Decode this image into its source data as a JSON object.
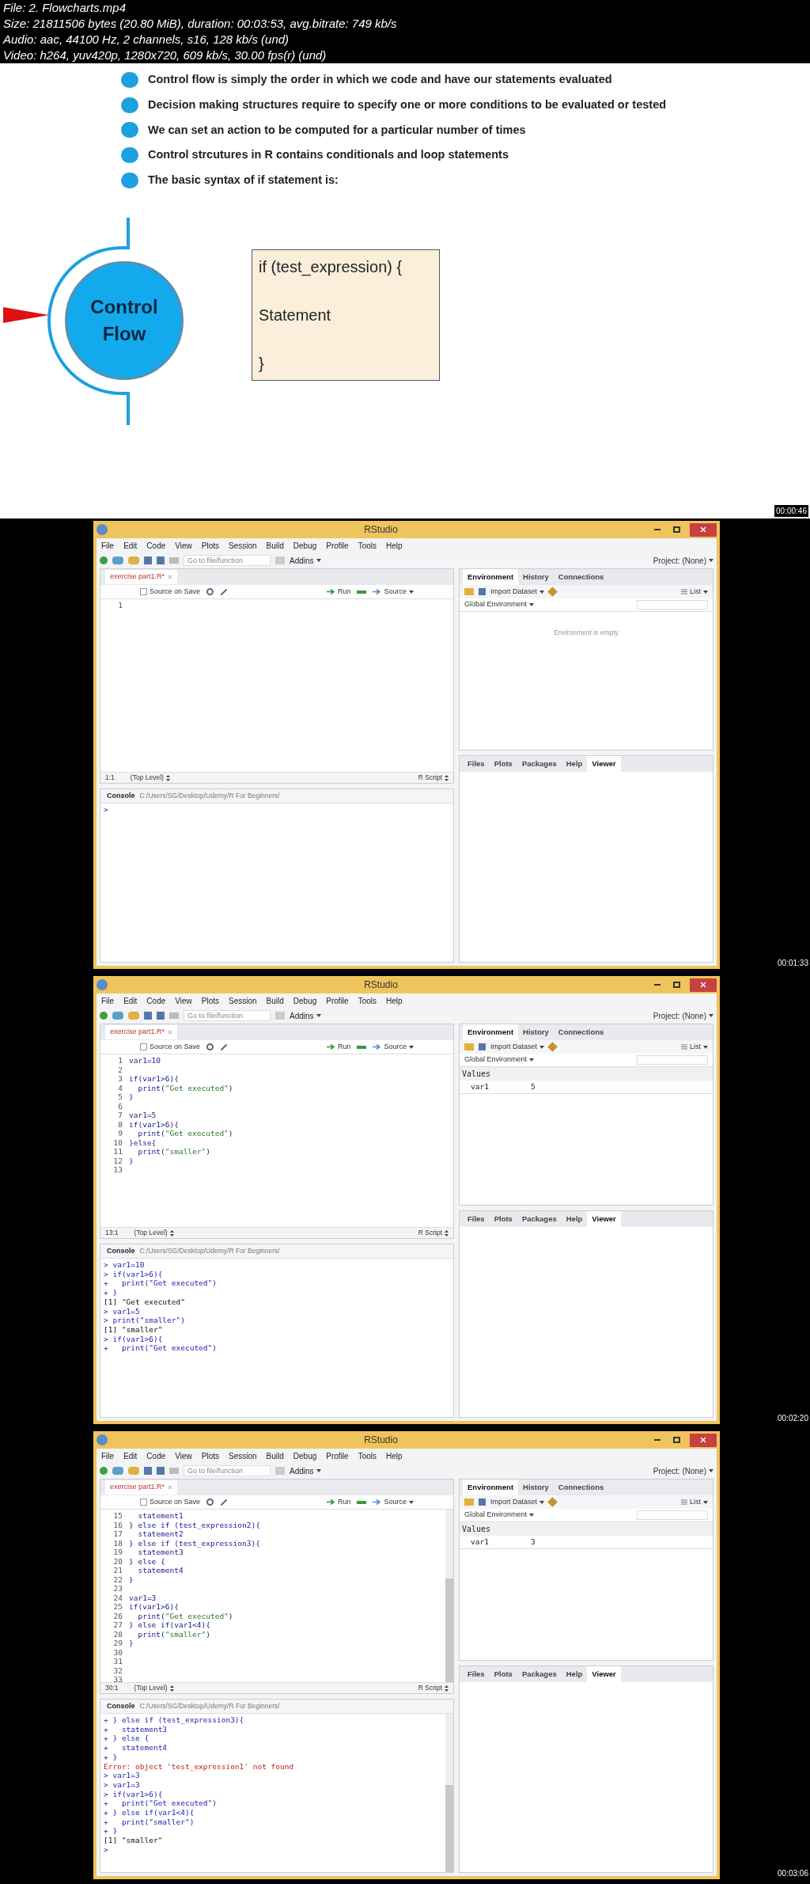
{
  "header": {
    "lines": [
      "File: 2. Flowcharts.mp4",
      "Size: 21811506 bytes (20.80 MiB), duration: 00:03:53, avg.bitrate: 749 kb/s",
      "Audio: aac, 44100 Hz, 2 channels, s16, 128 kb/s (und)",
      "Video: h264, yuv420p, 1280x720, 609 kb/s, 30.00 fps(r) (und)"
    ]
  },
  "frames": [
    {
      "kind": "slide",
      "bullets": [
        "Control flow is simply the order in which we code and have our statements evaluated",
        "Decision making structures require to specify one or more conditions to be evaluated or tested",
        "We can set an action to be computed for a particular number of times",
        "Control strcutures in R contains conditionals and loop statements",
        "The basic syntax of if statement is:"
      ],
      "circle_lines": [
        "Control",
        "Flow"
      ],
      "syntax_box": [
        "if (test_expression) {",
        "Statement",
        "}"
      ],
      "timestamp": "00:00:46"
    },
    {
      "kind": "rstudio",
      "title": "RStudio",
      "menu": [
        "File",
        "Edit",
        "Code",
        "View",
        "Plots",
        "Session",
        "Build",
        "Debug",
        "Profile",
        "Tools",
        "Help"
      ],
      "toolbar": {
        "goto_placeholder": "Go to file/function",
        "addins": "Addins",
        "project": "Project: (None)"
      },
      "editor": {
        "tab": "exercise part1.R*",
        "source_on_save": "Source on Save",
        "source_on_save_checked": false,
        "run": "Run",
        "source": "Source",
        "scrollbar": false,
        "lines": [
          {
            "n": "1"
          }
        ],
        "position": "1:1",
        "scope": "(Top Level)",
        "filetype": "R Script"
      },
      "console": {
        "title": "Console",
        "path": "C:/Users/SG/Desktop/Udemy/R For Beginners/",
        "scrollbar": false,
        "lines": [
          {
            "kind": "input",
            "text": ">"
          }
        ]
      },
      "environment": {
        "tabs": [
          {
            "label": "Environment",
            "selected": true
          },
          {
            "label": "History",
            "selected": false
          },
          {
            "label": "Connections",
            "selected": false
          }
        ],
        "import": "Import Dataset",
        "list": "List",
        "scope": "Global Environment",
        "empty_message": "Environment is empty"
      },
      "files": {
        "tabs": [
          {
            "label": "Files",
            "selected": false
          },
          {
            "label": "Plots",
            "selected": false
          },
          {
            "label": "Packages",
            "selected": false
          },
          {
            "label": "Help",
            "selected": false
          },
          {
            "label": "Viewer",
            "selected": true
          }
        ]
      },
      "timestamp": "00:01:33"
    },
    {
      "kind": "rstudio",
      "title": "RStudio",
      "menu": [
        "File",
        "Edit",
        "Code",
        "View",
        "Plots",
        "Session",
        "Build",
        "Debug",
        "Profile",
        "Tools",
        "Help"
      ],
      "toolbar": {
        "goto_placeholder": "Go to file/function",
        "addins": "Addins",
        "project": "Project: (None)"
      },
      "editor": {
        "tab": "exercise part1.R*",
        "source_on_save": "Source on Save",
        "source_on_save_checked": false,
        "run": "Run",
        "source": "Source",
        "scrollbar": false,
        "lines": [
          {
            "n": "1",
            "code": "var1=10"
          },
          {
            "n": "2"
          },
          {
            "n": "3",
            "code": "if(var1>6){"
          },
          {
            "n": "4",
            "code": "  print(\"Get executed\")"
          },
          {
            "n": "5",
            "code": "}"
          },
          {
            "n": "6"
          },
          {
            "n": "7",
            "code": "var1=5"
          },
          {
            "n": "8",
            "code": "if(var1>6){"
          },
          {
            "n": "9",
            "code": "  print(\"Get executed\")"
          },
          {
            "n": "10",
            "code": "}else{"
          },
          {
            "n": "11",
            "code": "  print(\"smaller\")"
          },
          {
            "n": "12",
            "code": "}"
          },
          {
            "n": "13"
          }
        ],
        "position": "13:1",
        "scope": "(Top Level)",
        "filetype": "R Script"
      },
      "console": {
        "title": "Console",
        "path": "C:/Users/SG/Desktop/Udemy/R For Beginners/",
        "scrollbar": false,
        "lines": [
          {
            "kind": "input",
            "text": "> var1=10"
          },
          {
            "kind": "input",
            "text": "> if(var1>6){"
          },
          {
            "kind": "input",
            "text": "+   print(\"Get executed\")"
          },
          {
            "kind": "input",
            "text": "+ }"
          },
          {
            "kind": "output",
            "text": "[1] \"Get executed\""
          },
          {
            "kind": "input",
            "text": "> var1=5"
          },
          {
            "kind": "input",
            "text": "> print(\"smaller\")"
          },
          {
            "kind": "output",
            "text": "[1] \"smaller\""
          },
          {
            "kind": "input",
            "text": "> if(var1>6){"
          },
          {
            "kind": "input",
            "text": "+   print(\"Get executed\")"
          }
        ]
      },
      "environment": {
        "tabs": [
          {
            "label": "Environment",
            "selected": true
          },
          {
            "label": "History",
            "selected": false
          },
          {
            "label": "Connections",
            "selected": false
          }
        ],
        "import": "Import Dataset",
        "list": "List",
        "scope": "Global Environment",
        "section": "Values",
        "values": [
          {
            "name": "var1",
            "value": "5"
          }
        ]
      },
      "files": {
        "tabs": [
          {
            "label": "Files",
            "selected": false
          },
          {
            "label": "Plots",
            "selected": false
          },
          {
            "label": "Packages",
            "selected": false
          },
          {
            "label": "Help",
            "selected": false
          },
          {
            "label": "Viewer",
            "selected": true
          }
        ]
      },
      "timestamp": "00:02:20"
    },
    {
      "kind": "rstudio",
      "title": "RStudio",
      "menu": [
        "File",
        "Edit",
        "Code",
        "View",
        "Plots",
        "Session",
        "Build",
        "Debug",
        "Profile",
        "Tools",
        "Help"
      ],
      "toolbar": {
        "goto_placeholder": "Go to file/function",
        "addins": "Addins",
        "project": "Project: (None)"
      },
      "editor": {
        "tab": "exercise part1.R*",
        "source_on_save": "Source on Save",
        "source_on_save_checked": false,
        "run": "Run",
        "source": "Source",
        "scrollbar": true,
        "lines": [
          {
            "n": "15",
            "code": "  statement1"
          },
          {
            "n": "16",
            "code": "} else if (test_expression2){"
          },
          {
            "n": "17",
            "code": "  statement2"
          },
          {
            "n": "18",
            "code": "} else if (test_expression3){"
          },
          {
            "n": "19",
            "code": "  statement3"
          },
          {
            "n": "20",
            "code": "} else {"
          },
          {
            "n": "21",
            "code": "  statement4"
          },
          {
            "n": "22",
            "code": "}"
          },
          {
            "n": "23"
          },
          {
            "n": "24",
            "code": "var1=3"
          },
          {
            "n": "25",
            "code": "if(var1>6){"
          },
          {
            "n": "26",
            "code": "  print(\"Get executed\")"
          },
          {
            "n": "27",
            "code": "} else if(var1<4){"
          },
          {
            "n": "28",
            "code": "  print(\"smaller\")"
          },
          {
            "n": "29",
            "code": "}"
          },
          {
            "n": "30"
          },
          {
            "n": "31"
          },
          {
            "n": "32"
          },
          {
            "n": "33"
          }
        ],
        "position": "30:1",
        "scope": "(Top Level)",
        "filetype": "R Script"
      },
      "console": {
        "title": "Console",
        "path": "C:/Users/SG/Desktop/Udemy/R For Beginners/",
        "scrollbar": true,
        "lines": [
          {
            "kind": "input",
            "text": "+ } else if (test_expression3){"
          },
          {
            "kind": "input",
            "text": "+   statement3"
          },
          {
            "kind": "input",
            "text": "+ } else {"
          },
          {
            "kind": "input",
            "text": "+   statement4"
          },
          {
            "kind": "input",
            "text": "+ }"
          },
          {
            "kind": "error",
            "text": "Error: object 'test_expression1' not found"
          },
          {
            "kind": "input",
            "text": "> var1=3"
          },
          {
            "kind": "input",
            "text": "> var1=3"
          },
          {
            "kind": "input",
            "text": "> if(var1>6){"
          },
          {
            "kind": "input",
            "text": "+   print(\"Get executed\")"
          },
          {
            "kind": "input",
            "text": "+ } else if(var1<4){"
          },
          {
            "kind": "input",
            "text": "+   print(\"smaller\")"
          },
          {
            "kind": "input",
            "text": "+ }"
          },
          {
            "kind": "output",
            "text": "[1] \"smaller\""
          },
          {
            "kind": "input",
            "text": ">"
          }
        ]
      },
      "environment": {
        "tabs": [
          {
            "label": "Environment",
            "selected": true
          },
          {
            "label": "History",
            "selected": false
          },
          {
            "label": "Connections",
            "selected": false
          }
        ],
        "import": "Import Dataset",
        "list": "List",
        "scope": "Global Environment",
        "section": "Values",
        "values": [
          {
            "name": "var1",
            "value": "3"
          }
        ]
      },
      "files": {
        "tabs": [
          {
            "label": "Files",
            "selected": false
          },
          {
            "label": "Plots",
            "selected": false
          },
          {
            "label": "Packages",
            "selected": false
          },
          {
            "label": "Help",
            "selected": false
          },
          {
            "label": "Viewer",
            "selected": true
          }
        ]
      },
      "timestamp": "00:03:06"
    }
  ]
}
